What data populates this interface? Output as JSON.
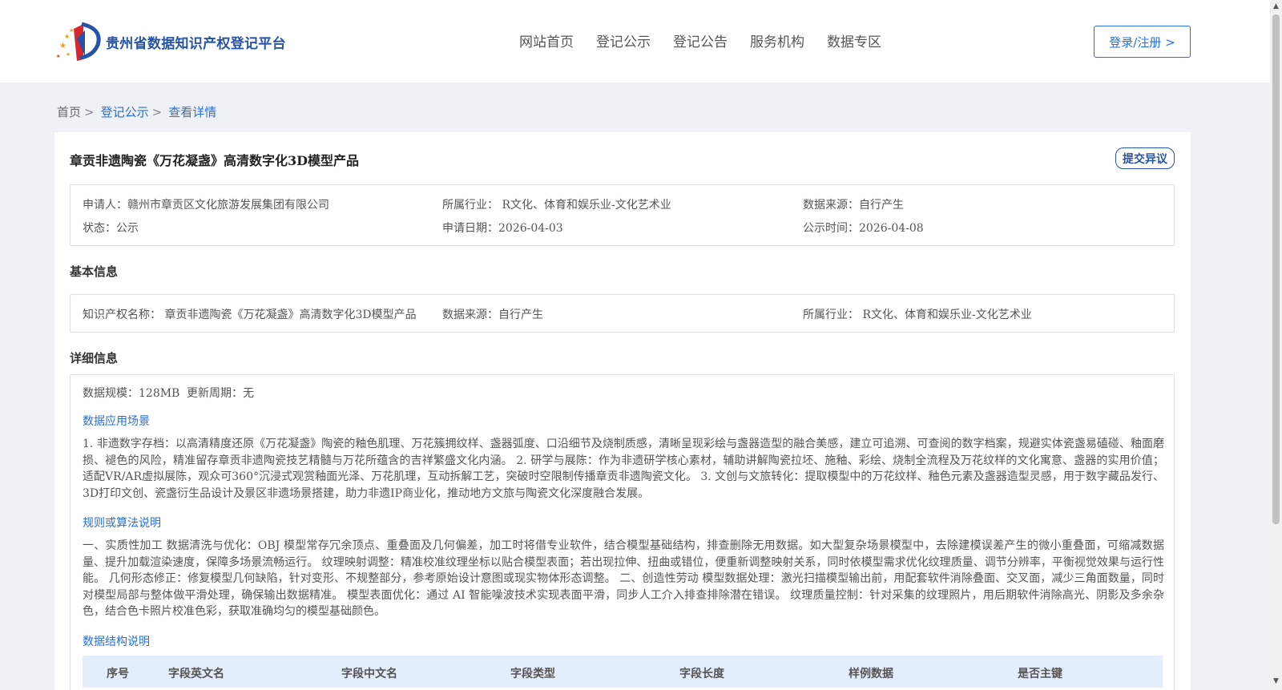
{
  "header": {
    "site_name": "贵州省数据知识产权登记平台",
    "nav": [
      "网站首页",
      "登记公示",
      "登记公告",
      "服务机构",
      "数据专区"
    ],
    "login_label": "登录/注册 >"
  },
  "breadcrumb": {
    "home": "首页",
    "section": "登记公示",
    "current": "查看详情",
    "sep": ">"
  },
  "detail": {
    "title": "章贡非遗陶瓷《万花凝盏》高清数字化3D模型产品",
    "objection_label": "提交异议",
    "summary": {
      "applicant": "申请人：赣州市章贡区文化旅游发展集团有限公司",
      "industry": "所属行业： R文化、体育和娱乐业-文化艺术业",
      "source": "数据来源：自行产生",
      "status": "状态：公示",
      "apply_date": "申请日期：2026-04-03",
      "publish_date": "公示时间：2026-04-08"
    },
    "basic": {
      "heading": "基本信息",
      "ip_name": "知识产权名称： 章贡非遗陶瓷《万花凝盏》高清数字化3D模型产品",
      "source": "数据来源：自行产生",
      "industry": "所属行业： R文化、体育和娱乐业-文化艺术业"
    },
    "detail_info": {
      "heading": "详细信息",
      "scale": "数据规模：128MB",
      "update_cycle": "更新周期：无",
      "scenario_heading": "数据应用场景",
      "scenario_text": "1. 非遗数字存档：以高清精度还原《万花凝盏》陶瓷的釉色肌理、万花簇拥纹样、盏器弧度、口沿细节及烧制质感，清晰呈现彩绘与盏器造型的融合美感，建立可追溯、可查阅的数字档案，规避实体瓷盏易磕碰、釉面磨损、褪色的风险，精准留存章贡非遗陶瓷技艺精髓与万花所蕴含的吉祥繁盛文化内涵。 2. 研学与展陈：作为非遗研学核心素材，辅助讲解陶瓷拉坯、施釉、彩绘、烧制全流程及万花纹样的文化寓意、盏器的实用价值；适配VR/AR虚拟展陈，观众可360°沉浸式观赏釉面光泽、万花肌理，互动拆解工艺，突破时空限制传播章贡非遗陶瓷文化。 3. 文创与文旅转化：提取模型中的万花纹样、釉色元素及盏器造型灵感，用于数字藏品发行、3D打印文创、瓷盏衍生品设计及景区非遗场景搭建，助力非遗IP商业化，推动地方文旅与陶瓷文化深度融合发展。",
      "rules_heading": "规则或算法说明",
      "rules_text": "一、实质性加工 数据清洗与优化：OBJ 模型常存冗余顶点、重叠面及几何偏差，加工时将借专业软件，结合模型基础结构，排查删除无用数据。如大型复杂场景模型中，去除建模误差产生的微小重叠面，可缩减数据量、提升加载渲染速度，保障多场景流畅运行。 纹理映射调整：精准校准纹理坐标以贴合模型表面；若出现拉伸、扭曲或错位，便重新调整映射关系，同时依模型需求优化纹理质量、调节分辨率，平衡视觉效果与运行性能。 几何形态修正：修复模型几何缺陷，针对变形、不规整部分，参考原始设计意图或现实物体形态调整。 二、创造性劳动 模型数据处理：激光扫描模型输出前，用配套软件消除叠面、交叉面，减少三角面数量，同时对模型局部与整体做平滑处理，确保输出数据精准。 模型表面优化：通过 AI 智能噪波技术实现表面平滑，同步人工介入排查排除潜在错误。 纹理质量控制：针对采集的纹理照片，用后期软件消除高光、阴影及多余杂色，结合色卡照片校准色彩，获取准确均匀的模型基础颜色。",
      "structure_heading": "数据结构说明",
      "table_headers": [
        "序号",
        "字段英文名",
        "字段中文名",
        "字段类型",
        "字段长度",
        "样例数据",
        "是否主键"
      ]
    }
  },
  "colors": {
    "accent": "#2a6fdb",
    "brand": "#2553a8",
    "page_bg": "#eef1f6",
    "table_head_bg": "#e3edfb"
  }
}
